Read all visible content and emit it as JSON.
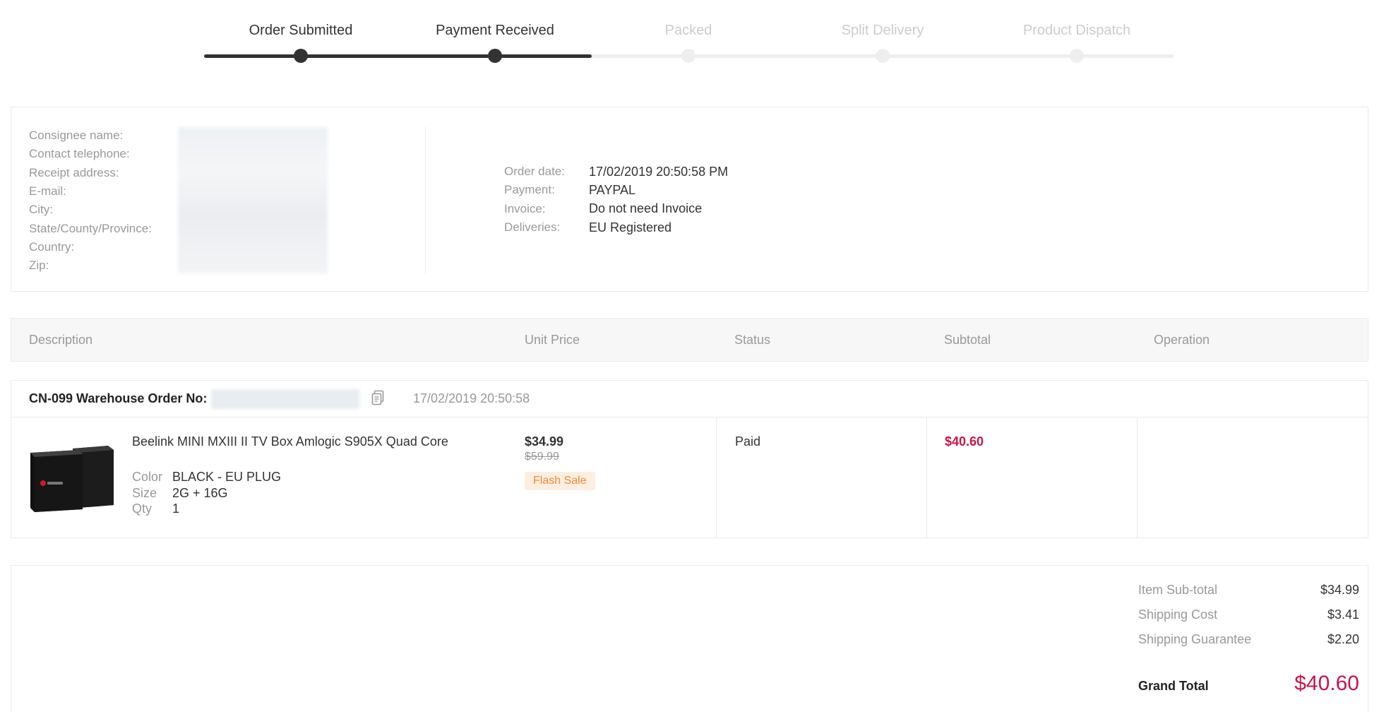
{
  "steps": [
    {
      "label": "Order Submitted",
      "done": true
    },
    {
      "label": "Payment Received",
      "done": true
    },
    {
      "label": "Packed",
      "done": false
    },
    {
      "label": "Split Delivery",
      "done": false
    },
    {
      "label": "Product Dispatch",
      "done": false
    }
  ],
  "consignee": {
    "labels": {
      "name": "Consignee name:",
      "telephone": "Contact telephone:",
      "address": "Receipt address:",
      "email": "E-mail:",
      "city": "City:",
      "state": "State/County/Province:",
      "country": "Country:",
      "zip": "Zip:"
    }
  },
  "order_info": {
    "order_date_label": "Order date:",
    "order_date": "17/02/2019 20:50:58 PM",
    "payment_label": "Payment:",
    "payment": "PAYPAL",
    "invoice_label": "Invoice:",
    "invoice": "Do not need Invoice",
    "deliveries_label": "Deliveries:",
    "deliveries": "EU Registered"
  },
  "table": {
    "headers": {
      "description": "Description",
      "unit_price": "Unit Price",
      "status": "Status",
      "subtotal": "Subtotal",
      "operation": "Operation"
    }
  },
  "order": {
    "warehouse_label": "CN-099 Warehouse Order No:",
    "time": "17/02/2019 20:50:58",
    "item": {
      "name": "Beelink MINI MXIII II TV Box Amlogic S905X Quad Core",
      "color_label": "Color",
      "color": "BLACK - EU PLUG",
      "size_label": "Size",
      "size": "2G + 16G",
      "qty_label": "Qty",
      "qty": "1",
      "price": "$34.99",
      "old_price": "$59.99",
      "badge": "Flash Sale",
      "status": "Paid",
      "subtotal": "$40.60"
    }
  },
  "totals": {
    "item_subtotal_label": "Item Sub-total",
    "item_subtotal": "$34.99",
    "shipping_cost_label": "Shipping Cost",
    "shipping_cost": "$3.41",
    "shipping_guarantee_label": "Shipping Guarantee",
    "shipping_guarantee": "$2.20",
    "grand_total_label": "Grand Total",
    "grand_total": "$40.60"
  },
  "colors": {
    "accent": "#c6154a",
    "badge_bg": "#fdeee0",
    "badge_text": "#ee8b3b",
    "step_done": "#333333",
    "step_pending": "#eeeeee"
  }
}
